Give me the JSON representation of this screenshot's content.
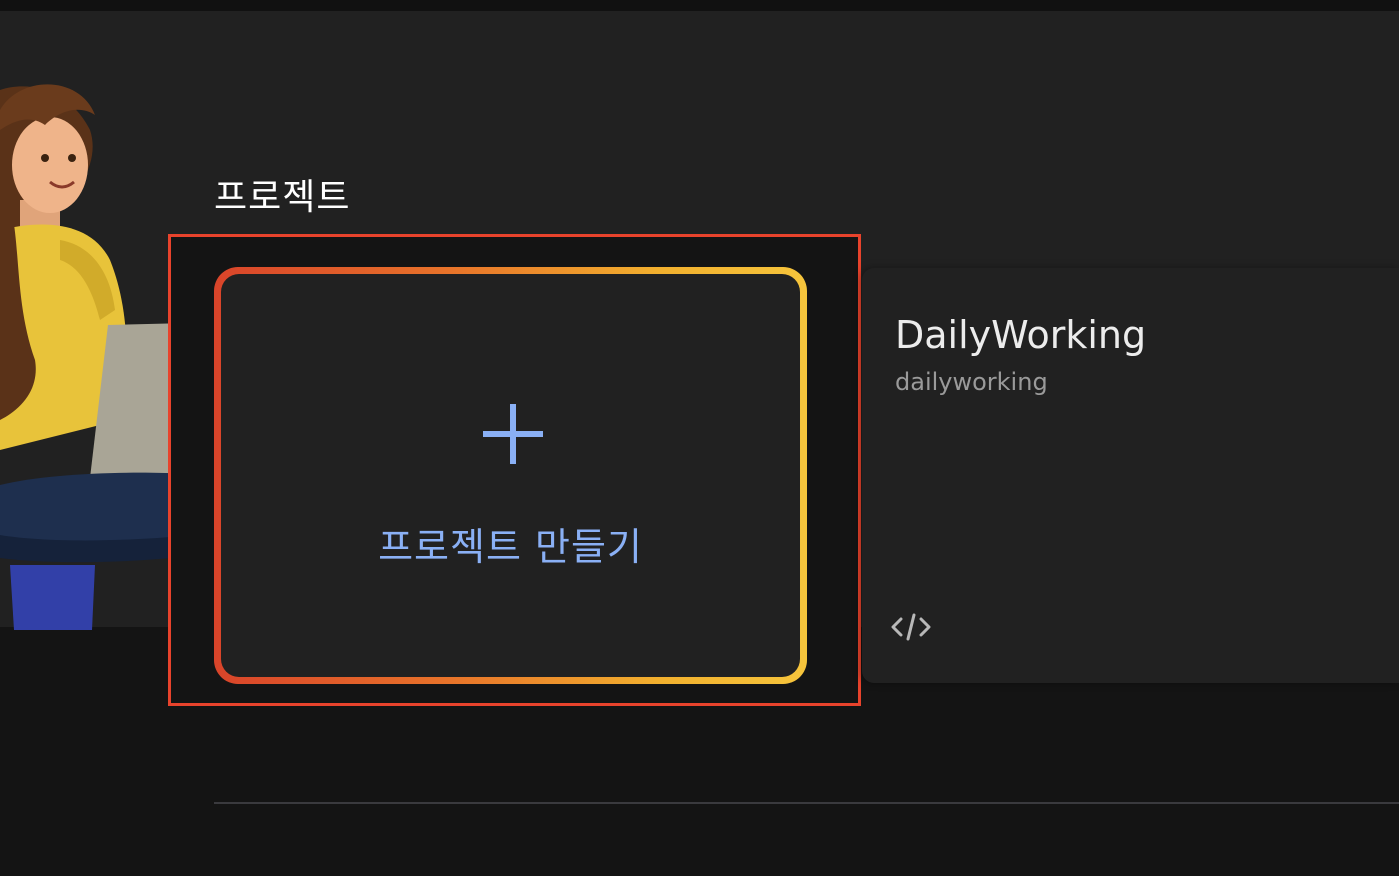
{
  "section": {
    "title": "프로젝트"
  },
  "create_card": {
    "icon": "plus-icon",
    "label": "프로젝트 만들기",
    "gradient_colors": [
      "#d9442a",
      "#f6c53c"
    ],
    "label_color": "#8ab0f5"
  },
  "project_card": {
    "name": "DailyWorking",
    "id": "dailyworking",
    "icon": "code-icon"
  },
  "highlight_color": "#e8432c"
}
